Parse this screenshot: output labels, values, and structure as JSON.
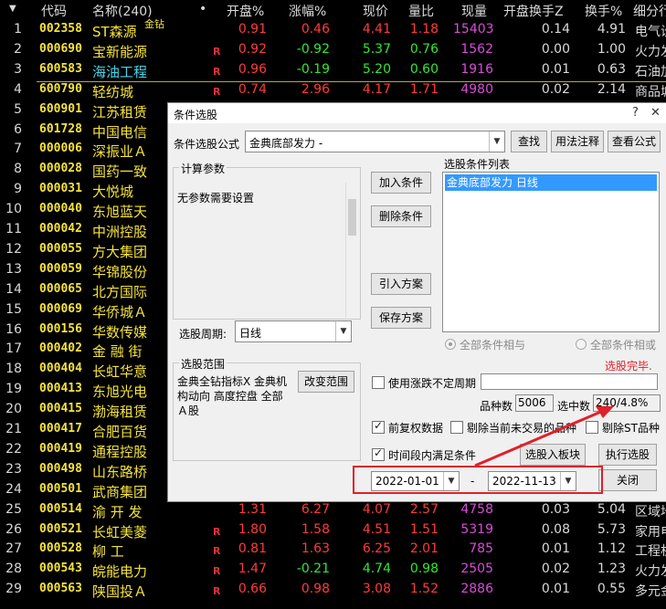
{
  "table": {
    "headers": {
      "code": "代码",
      "name": "名称(240)",
      "dot": "•",
      "open": "开盘%",
      "chg": "涨幅%",
      "price": "现价",
      "ratio": "量比",
      "vol": "现量",
      "turn_open": "开盘换手Z",
      "turn": "换手%",
      "ind": "细分行"
    },
    "rows": [
      {
        "idx": "1",
        "code": "002358",
        "name": "ST森源",
        "badge": "金钻",
        "r": "",
        "open": "0.91",
        "chg": "0.46",
        "price": "4.41",
        "ratio": "1.18",
        "vol": "15403",
        "turn_open": "0.14",
        "turn": "4.91",
        "ind": "电气设"
      },
      {
        "idx": "2",
        "code": "000690",
        "name": "宝新能源",
        "badge": "",
        "r": "R",
        "open": "0.92",
        "chg": "-0.92",
        "price": "5.37",
        "ratio": "0.76",
        "vol": "1562",
        "turn_open": "0.00",
        "turn": "1.00",
        "ind": "火力发"
      },
      {
        "idx": "3",
        "code": "600583",
        "name": "海油工程",
        "badge": "",
        "r": "R",
        "open": "0.96",
        "chg": "-0.19",
        "price": "5.20",
        "ratio": "0.60",
        "vol": "1916",
        "turn_open": "0.01",
        "turn": "0.63",
        "ind": "石油加"
      },
      {
        "idx": "4",
        "code": "600790",
        "name": "轻纺城",
        "badge": "",
        "r": "R",
        "open": "0.74",
        "chg": "2.96",
        "price": "4.17",
        "ratio": "1.71",
        "vol": "4980",
        "turn_open": "0.02",
        "turn": "2.14",
        "ind": "商品城"
      },
      {
        "idx": "5",
        "code": "600901",
        "name": "江苏租赁"
      },
      {
        "idx": "6",
        "code": "601728",
        "name": "中国电信"
      },
      {
        "idx": "7",
        "code": "000006",
        "name": "深振业Ａ"
      },
      {
        "idx": "8",
        "code": "000028",
        "name": "国药一致"
      },
      {
        "idx": "9",
        "code": "000031",
        "name": "大悦城"
      },
      {
        "idx": "10",
        "code": "000040",
        "name": "东旭蓝天"
      },
      {
        "idx": "11",
        "code": "000042",
        "name": "中洲控股"
      },
      {
        "idx": "12",
        "code": "000055",
        "name": "方大集团"
      },
      {
        "idx": "13",
        "code": "000059",
        "name": "华锦股份"
      },
      {
        "idx": "14",
        "code": "000065",
        "name": "北方国际"
      },
      {
        "idx": "15",
        "code": "000069",
        "name": "华侨城Ａ"
      },
      {
        "idx": "16",
        "code": "000156",
        "name": "华数传媒"
      },
      {
        "idx": "17",
        "code": "000402",
        "name": "金 融 街"
      },
      {
        "idx": "18",
        "code": "000404",
        "name": "长虹华意"
      },
      {
        "idx": "19",
        "code": "000413",
        "name": "东旭光电"
      },
      {
        "idx": "20",
        "code": "000415",
        "name": "渤海租赁"
      },
      {
        "idx": "21",
        "code": "000417",
        "name": "合肥百货"
      },
      {
        "idx": "22",
        "code": "000419",
        "name": "通程控股"
      },
      {
        "idx": "23",
        "code": "000498",
        "name": "山东路桥"
      },
      {
        "idx": "24",
        "code": "000501",
        "name": "武商集团"
      },
      {
        "idx": "25",
        "code": "000514",
        "name": "渝 开 发",
        "badge": "",
        "r": "",
        "open": "1.31",
        "chg": "6.27",
        "price": "4.07",
        "ratio": "2.57",
        "vol": "4758",
        "turn_open": "0.03",
        "turn": "5.04",
        "ind": "区域地"
      },
      {
        "idx": "26",
        "code": "000521",
        "name": "长虹美菱",
        "badge": "",
        "r": "R",
        "open": "1.80",
        "chg": "1.58",
        "price": "4.51",
        "ratio": "1.51",
        "vol": "5319",
        "turn_open": "0.08",
        "turn": "5.73",
        "ind": "家用电"
      },
      {
        "idx": "27",
        "code": "000528",
        "name": "柳 工",
        "badge": "",
        "r": "R",
        "open": "0.81",
        "chg": "1.63",
        "price": "6.25",
        "ratio": "2.01",
        "vol": "785",
        "turn_open": "0.01",
        "turn": "1.12",
        "ind": "工程机"
      },
      {
        "idx": "28",
        "code": "000543",
        "name": "皖能电力",
        "badge": "",
        "r": "R",
        "open": "1.47",
        "chg": "-0.21",
        "price": "4.74",
        "ratio": "0.98",
        "vol": "2505",
        "turn_open": "0.02",
        "turn": "1.23",
        "ind": "火力发"
      },
      {
        "idx": "29",
        "code": "000563",
        "name": "陕国投Ａ",
        "badge": "",
        "r": "R",
        "open": "0.66",
        "chg": "0.98",
        "price": "3.08",
        "ratio": "1.52",
        "vol": "2886",
        "turn_open": "0.01",
        "turn": "0.55",
        "ind": "多元金"
      }
    ]
  },
  "dialog": {
    "title": "条件选股",
    "help_btn": "?",
    "close_btn": "✕",
    "formula_label": "条件选股公式",
    "formula_value": "金典底部发力 -",
    "query_btn": "查找",
    "usage_btn": "用法注释",
    "view_formula_btn": "查看公式",
    "calc_params_title": "计算参数",
    "no_params_text": "无参数需要设置",
    "add_condition_btn": "加入条件",
    "delete_condition_btn": "删除条件",
    "import_plan_btn": "引入方案",
    "save_plan_btn": "保存方案",
    "condition_list_title": "选股条件列表",
    "condition_item": "金典底部发力  日线",
    "period_label": "选股周期:",
    "period_value": "日线",
    "radio_and": "全部条件相与",
    "radio_or": "全部条件相或",
    "scope_title": "选股范围",
    "scope_text": "金典全钻指标X 金典机构动向 高度控盘 全部Ａ股",
    "change_scope_btn": "改变范围",
    "use_limit_label": "使用涨跌不定周期",
    "status_text": "选股完毕.",
    "count_label": "品种数",
    "count_value": "5006",
    "selected_label": "选中数",
    "selected_value": "240/4.8%",
    "pre_adjust_label": "前复权数据",
    "exclude_untraded_label": "剔除当前未交易的品种",
    "exclude_st_label": "剔除ST品种",
    "time_range_label": "时间段内满足条件",
    "select_to_block_btn": "选股入板块",
    "execute_btn": "执行选股",
    "date_from": "2022-01-01",
    "date_sep": "-",
    "date_to": "2022-11-13",
    "close_btn_label": "关闭"
  },
  "colors": {
    "up": "#ff3b3b",
    "down": "#33e633",
    "code": "#f5e33b",
    "volume": "#d94cd9",
    "highlight": "#e0202a",
    "selection": "#3399ff"
  }
}
